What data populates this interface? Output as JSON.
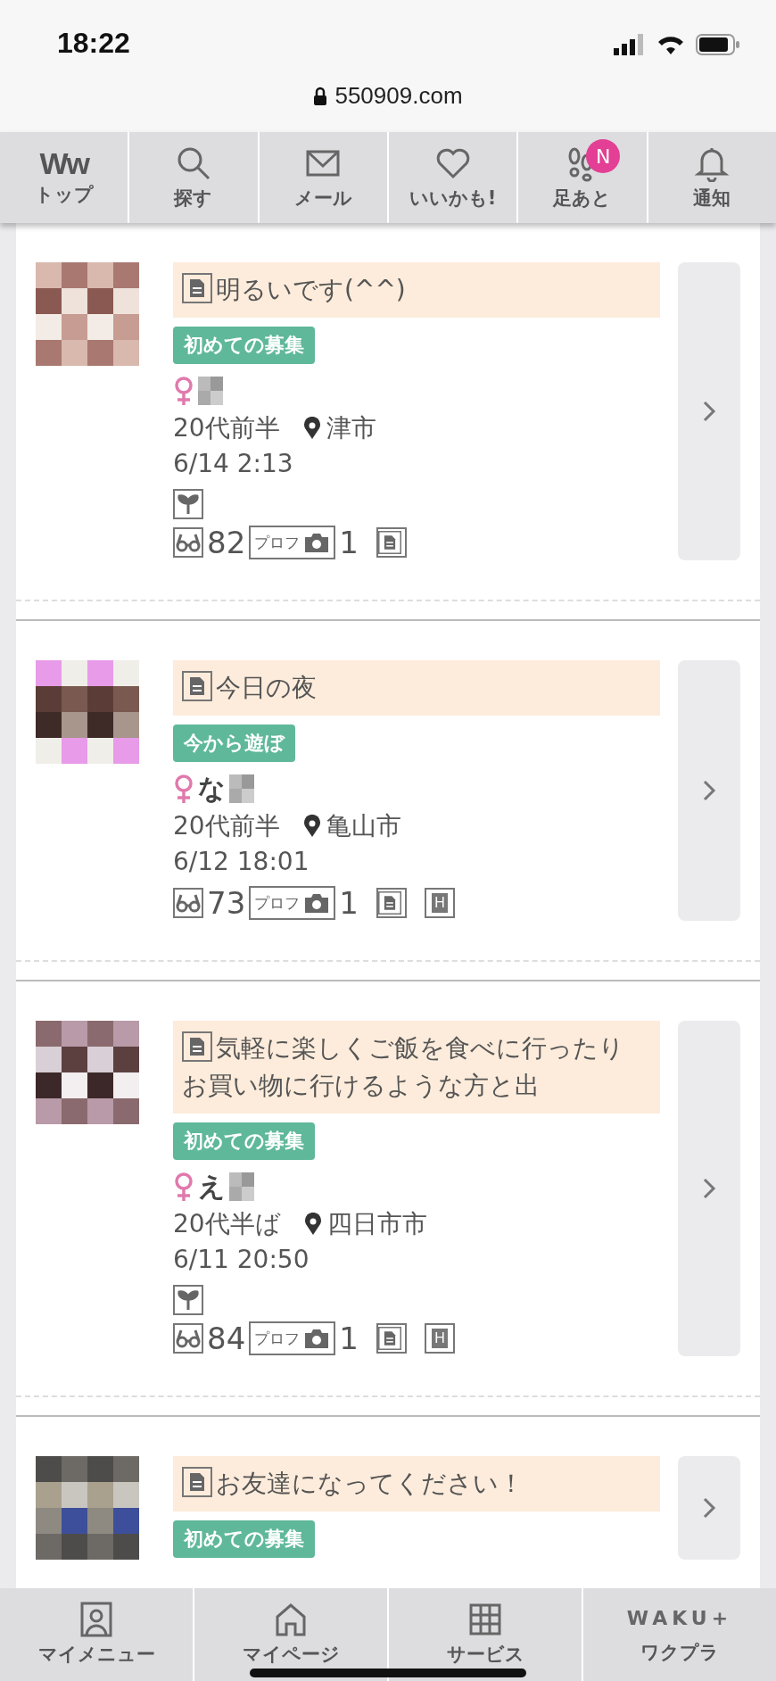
{
  "status_bar": {
    "time": "18:22",
    "url": "550909.com"
  },
  "top_nav": [
    {
      "kind": "logo",
      "logo": "Ww",
      "label": "トップ"
    },
    {
      "kind": "search",
      "label": "探す"
    },
    {
      "kind": "mail",
      "label": "メール"
    },
    {
      "kind": "heart",
      "label": "いいかも!"
    },
    {
      "kind": "footprints",
      "label": "足あと",
      "badge": "N"
    },
    {
      "kind": "bell",
      "label": "通知"
    }
  ],
  "posts": [
    {
      "message": "明るいです(^^)",
      "tag": "初めての募集",
      "age": "20代前半",
      "location": "津市",
      "time": "6/14 2:13",
      "beginner": true,
      "views": "82",
      "prof_label": "プロフ",
      "photos": "1",
      "badges": [
        {
          "kind": "memo"
        }
      ]
    },
    {
      "message": "今日の夜",
      "tag": "今から遊ぼ",
      "name": "な",
      "age": "20代前半",
      "location": "亀山市",
      "time": "6/12 18:01",
      "beginner": false,
      "views": "73",
      "prof_label": "プロフ",
      "photos": "1",
      "badges": [
        {
          "kind": "memo"
        },
        {
          "kind": "letter",
          "label": "H"
        }
      ]
    },
    {
      "message": "気軽に楽しくご飯を食べに行ったりお買い物に行けるような方と出",
      "tag": "初めての募集",
      "name": "え",
      "age": "20代半ば",
      "location": "四日市市",
      "time": "6/11 20:50",
      "beginner": true,
      "views": "84",
      "prof_label": "プロフ",
      "photos": "1",
      "badges": [
        {
          "kind": "memo"
        },
        {
          "kind": "letter",
          "label": "H"
        }
      ]
    },
    {
      "message": "お友達になってください！",
      "tag": "初めての募集"
    }
  ],
  "bottom_nav": [
    {
      "kind": "person",
      "label": "マイメニュー"
    },
    {
      "kind": "home",
      "label": "マイページ"
    },
    {
      "kind": "grid",
      "label": "サービス"
    },
    {
      "kind": "logo",
      "logo": "WAKU+",
      "label": "ワクプラ"
    }
  ]
}
